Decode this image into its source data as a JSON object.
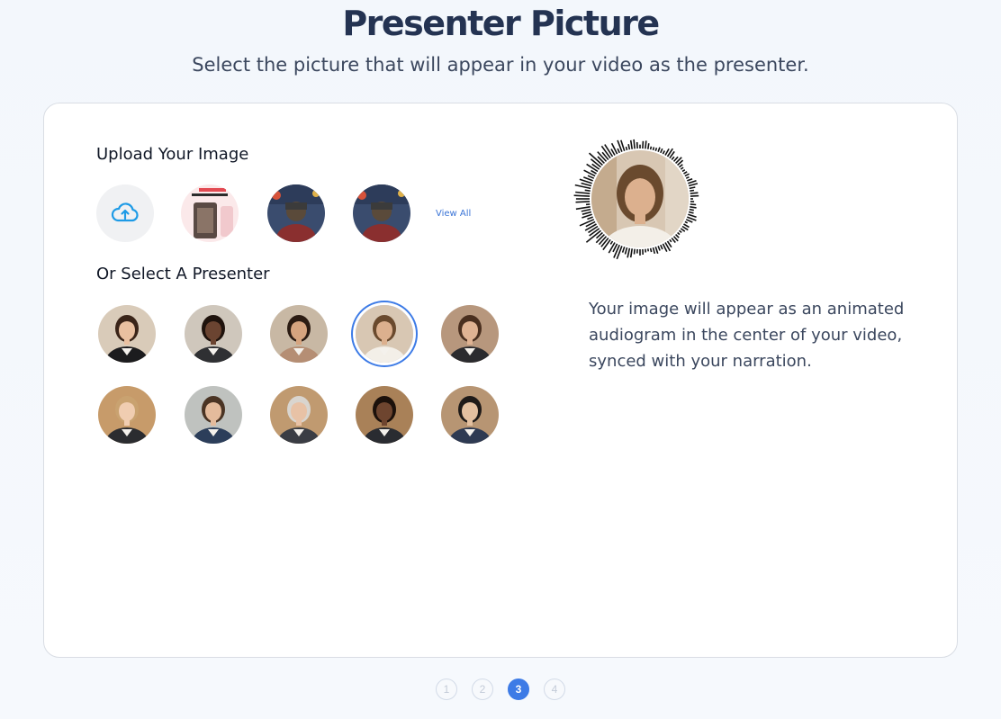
{
  "header": {
    "title": "Presenter Picture",
    "subtitle": "Select the picture that will appear in your video as the presenter."
  },
  "upload": {
    "heading": "Upload Your Image",
    "view_all_label": "View All",
    "items": [
      {
        "kind": "upload",
        "icon": "cloud-upload-icon"
      },
      {
        "kind": "thumbnail",
        "name": "uploaded-image-1"
      },
      {
        "kind": "thumbnail",
        "name": "uploaded-image-2"
      },
      {
        "kind": "thumbnail",
        "name": "uploaded-image-3"
      }
    ]
  },
  "presenters": {
    "heading": "Or Select A Presenter",
    "rows": [
      [
        {
          "name": "presenter-1",
          "skin": "#e9c0a0",
          "hair": "#3a2418",
          "outfit": "#1c1c1e",
          "bg": "#d9cbb9"
        },
        {
          "name": "presenter-2",
          "skin": "#6b4431",
          "hair": "#1f130d",
          "outfit": "#2f3033",
          "bg": "#cfc7bc"
        },
        {
          "name": "presenter-3",
          "skin": "#d6a47f",
          "hair": "#2c1c13",
          "outfit": "#b58e74",
          "bg": "#c8b8a4"
        },
        {
          "name": "presenter-4",
          "skin": "#dcb08e",
          "hair": "#6a4a2e",
          "outfit": "#f3efe8",
          "bg": "#d8c7b3",
          "selected": true
        },
        {
          "name": "presenter-5",
          "skin": "#e0b393",
          "hair": "#4a2f1f",
          "outfit": "#2b2b2e",
          "bg": "#b7977d"
        }
      ],
      [
        {
          "name": "presenter-6",
          "skin": "#f0cdb1",
          "hair": "#c9a270",
          "outfit": "#2b2c30",
          "bg": "#c79b6a"
        },
        {
          "name": "presenter-7",
          "skin": "#e4bb9c",
          "hair": "#4a3424",
          "outfit": "#2c3e5a",
          "bg": "#bfc2bf"
        },
        {
          "name": "presenter-8",
          "skin": "#e8c2a6",
          "hair": "#d9d5cf",
          "outfit": "#3a3d44",
          "bg": "#c09a70"
        },
        {
          "name": "presenter-9",
          "skin": "#6e452f",
          "hair": "#1c110b",
          "outfit": "#2a2c31",
          "bg": "#a98158"
        },
        {
          "name": "presenter-10",
          "skin": "#e3c0a0",
          "hair": "#1e1a18",
          "outfit": "#2e3a52",
          "bg": "#b79573"
        }
      ]
    ]
  },
  "preview": {
    "description": "Your image will appear as an animated audiogram in the center of your video, synced with your narration."
  },
  "stepper": {
    "steps": [
      "1",
      "2",
      "3",
      "4"
    ],
    "active_index": 2
  },
  "colors": {
    "accent": "#3d7be6",
    "upload_icon": "#1e9be6",
    "title": "#243352"
  }
}
